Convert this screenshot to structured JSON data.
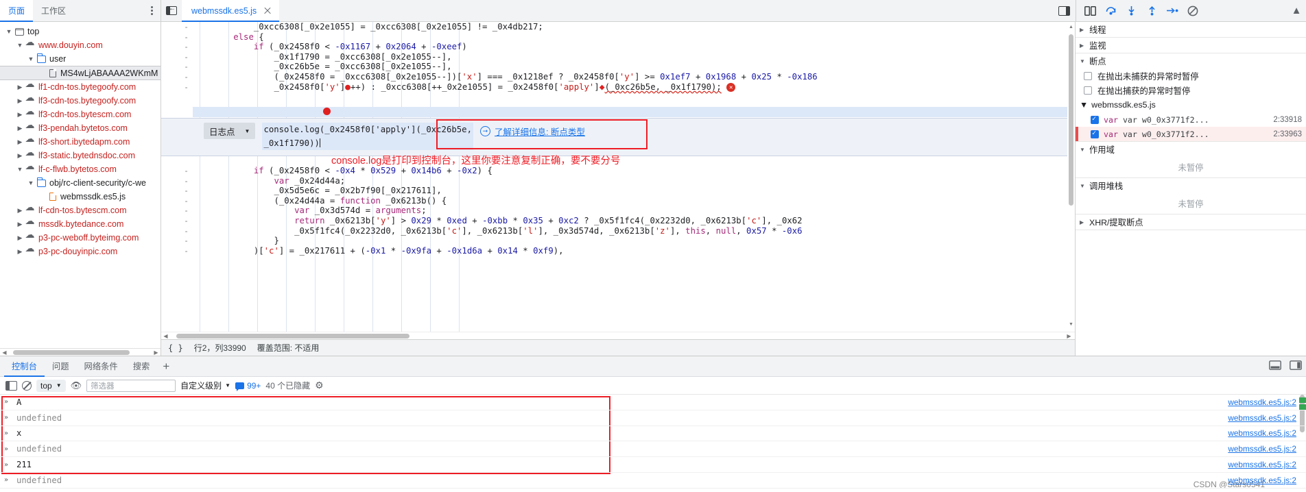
{
  "navigator": {
    "tabs": [
      {
        "label": "页面",
        "active": true
      },
      {
        "label": "工作区",
        "active": false
      }
    ],
    "more_label": "更多选项",
    "tree": [
      {
        "label": "top",
        "icon": "frame-icon",
        "depth": 0,
        "twisty": "open",
        "kind": "frame"
      },
      {
        "label": "www.douyin.com",
        "icon": "cloud-icon",
        "depth": 1,
        "twisty": "open",
        "kind": "host"
      },
      {
        "label": "user",
        "icon": "folder-icon",
        "depth": 2,
        "twisty": "open",
        "kind": "folder"
      },
      {
        "label": "MS4wLjABAAAA2WKmM",
        "icon": "document-icon",
        "depth": 3,
        "twisty": "none",
        "kind": "doc",
        "selected": true
      },
      {
        "label": "lf1-cdn-tos.bytegoofy.com",
        "icon": "cloud-icon",
        "depth": 1,
        "twisty": "closed",
        "kind": "host"
      },
      {
        "label": "lf3-cdn-tos.bytegoofy.com",
        "icon": "cloud-icon",
        "depth": 1,
        "twisty": "closed",
        "kind": "host"
      },
      {
        "label": "lf3-cdn-tos.bytescm.com",
        "icon": "cloud-icon",
        "depth": 1,
        "twisty": "closed",
        "kind": "host"
      },
      {
        "label": "lf3-pendah.bytetos.com",
        "icon": "cloud-icon",
        "depth": 1,
        "twisty": "closed",
        "kind": "host"
      },
      {
        "label": "lf3-short.ibytedapm.com",
        "icon": "cloud-icon",
        "depth": 1,
        "twisty": "closed",
        "kind": "host"
      },
      {
        "label": "lf3-static.bytednsdoc.com",
        "icon": "cloud-icon",
        "depth": 1,
        "twisty": "closed",
        "kind": "host"
      },
      {
        "label": "lf-c-flwb.bytetos.com",
        "icon": "cloud-icon",
        "depth": 1,
        "twisty": "open",
        "kind": "host"
      },
      {
        "label": "obj/rc-client-security/c-we",
        "icon": "folder-icon",
        "depth": 2,
        "twisty": "open",
        "kind": "folder"
      },
      {
        "label": "webmssdk.es5.js",
        "icon": "js-document-icon",
        "depth": 3,
        "twisty": "none",
        "kind": "js"
      },
      {
        "label": "lf-cdn-tos.bytescm.com",
        "icon": "cloud-icon",
        "depth": 1,
        "twisty": "closed",
        "kind": "host"
      },
      {
        "label": "mssdk.bytedance.com",
        "icon": "cloud-icon",
        "depth": 1,
        "twisty": "closed",
        "kind": "host"
      },
      {
        "label": "p3-pc-weboff.byteimg.com",
        "icon": "cloud-icon",
        "depth": 1,
        "twisty": "closed",
        "kind": "host"
      },
      {
        "label": "p3-pc-douyinpic.com",
        "icon": "cloud-icon",
        "depth": 1,
        "twisty": "closed",
        "kind": "host"
      }
    ]
  },
  "editor": {
    "tab_label": "webmssdk.es5.js",
    "close_label": "关闭",
    "show_navigator_label": "显示导航器",
    "status": {
      "format_label": "{ }",
      "position": "行2，列33990",
      "coverage": "覆盖范围: 不适用"
    },
    "lines": [
      {
        "gutter": "-",
        "indent": 0,
        "tokens": [
          {
            "t": "            ",
            "c": "plain"
          },
          {
            "t": "_0xcc6308[_0x2e1055] = _0xcc6308[_0x2e1055] != _0x4db217;",
            "c": "plain"
          }
        ]
      },
      {
        "gutter": "-",
        "indent": 0,
        "tokens": [
          {
            "t": "        ",
            "c": "plain"
          },
          {
            "t": "else",
            "c": "kw"
          },
          {
            "t": " {",
            "c": "plain"
          }
        ]
      },
      {
        "gutter": "-",
        "indent": 0,
        "tokens": [
          {
            "t": "            ",
            "c": "plain"
          },
          {
            "t": "if",
            "c": "kw"
          },
          {
            "t": " (_0x2458f0 < ",
            "c": "plain"
          },
          {
            "t": "-0x1167",
            "c": "num"
          },
          {
            "t": " + ",
            "c": "plain"
          },
          {
            "t": "0x2064",
            "c": "num"
          },
          {
            "t": " + ",
            "c": "plain"
          },
          {
            "t": "-0xeef",
            "c": "num"
          },
          {
            "t": ")",
            "c": "plain"
          }
        ]
      },
      {
        "gutter": "-",
        "indent": 0,
        "tokens": [
          {
            "t": "                _0x1f1790 = _0xcc6308[_0x2e1055--],",
            "c": "plain"
          }
        ]
      },
      {
        "gutter": "-",
        "indent": 0,
        "tokens": [
          {
            "t": "                _0xc26b5e = _0xcc6308[_0x2e1055--],",
            "c": "plain"
          }
        ]
      },
      {
        "gutter": "-",
        "indent": 0,
        "tokens": [
          {
            "t": "                (_0x2458f0 = _0xcc6308[_0x2e1055--])[",
            "c": "plain"
          },
          {
            "t": "'x'",
            "c": "str"
          },
          {
            "t": "] === _0x1218ef ? _0x2458f0[",
            "c": "plain"
          },
          {
            "t": "'y'",
            "c": "str"
          },
          {
            "t": "] >= ",
            "c": "plain"
          },
          {
            "t": "0x1ef7",
            "c": "num"
          },
          {
            "t": " + ",
            "c": "plain"
          },
          {
            "t": "0x1968",
            "c": "num"
          },
          {
            "t": " + ",
            "c": "plain"
          },
          {
            "t": "0x25",
            "c": "num"
          },
          {
            "t": " * ",
            "c": "plain"
          },
          {
            "t": "-0x186",
            "c": "num"
          }
        ]
      },
      {
        "gutter": "-",
        "indent": 0,
        "breakpoint": true,
        "tokens": [
          {
            "t": "                _0x2458f0[",
            "c": "plain"
          },
          {
            "t": "'y'",
            "c": "str"
          },
          {
            "t": "]",
            "c": "plain"
          },
          {
            "t": "●",
            "c": "bpdot"
          },
          {
            "t": "++) : _0xcc6308[++_0x2e1055] = _0x2458f0[",
            "c": "plain"
          },
          {
            "t": "'apply'",
            "c": "str"
          },
          {
            "t": "]",
            "c": "plain"
          },
          {
            "t": "◆",
            "c": "bpdot"
          },
          {
            "t": "(_0xc26b5e, _0x1f1790);",
            "c": "squiggle"
          },
          {
            "t": " ✕",
            "c": "errx"
          }
        ]
      }
    ],
    "lines_after": [
      {
        "gutter": "-",
        "tokens": [
          {
            "t": "            ",
            "c": "plain"
          },
          {
            "t": "if",
            "c": "kw"
          },
          {
            "t": " (_0x2458f0 < ",
            "c": "plain"
          },
          {
            "t": "-0x4",
            "c": "num"
          },
          {
            "t": " * ",
            "c": "plain"
          },
          {
            "t": "0x529",
            "c": "num"
          },
          {
            "t": " + ",
            "c": "plain"
          },
          {
            "t": "0x14b6",
            "c": "num"
          },
          {
            "t": " + ",
            "c": "plain"
          },
          {
            "t": "-0x2",
            "c": "num"
          },
          {
            "t": ") {",
            "c": "plain"
          }
        ]
      },
      {
        "gutter": "-",
        "tokens": [
          {
            "t": "                ",
            "c": "plain"
          },
          {
            "t": "var",
            "c": "kw"
          },
          {
            "t": " _0x24d44a;",
            "c": "plain"
          }
        ]
      },
      {
        "gutter": "-",
        "tokens": [
          {
            "t": "                _0x5d5e6c = _0x2b7f90[_0x217611],",
            "c": "plain"
          }
        ]
      },
      {
        "gutter": "-",
        "tokens": [
          {
            "t": "                (_0x24d44a = ",
            "c": "plain"
          },
          {
            "t": "function",
            "c": "kw"
          },
          {
            "t": " _0x6213b() {",
            "c": "plain"
          }
        ]
      },
      {
        "gutter": "-",
        "tokens": [
          {
            "t": "                    ",
            "c": "plain"
          },
          {
            "t": "var",
            "c": "kw"
          },
          {
            "t": " _0x3d574d = ",
            "c": "plain"
          },
          {
            "t": "arguments",
            "c": "kwv"
          },
          {
            "t": ";",
            "c": "plain"
          }
        ]
      },
      {
        "gutter": "-",
        "tokens": [
          {
            "t": "                    ",
            "c": "plain"
          },
          {
            "t": "return",
            "c": "kw"
          },
          {
            "t": " _0x6213b[",
            "c": "plain"
          },
          {
            "t": "'y'",
            "c": "str"
          },
          {
            "t": "] > ",
            "c": "plain"
          },
          {
            "t": "0x29",
            "c": "num"
          },
          {
            "t": " * ",
            "c": "plain"
          },
          {
            "t": "0xed",
            "c": "num"
          },
          {
            "t": " + ",
            "c": "plain"
          },
          {
            "t": "-0xbb",
            "c": "num"
          },
          {
            "t": " * ",
            "c": "plain"
          },
          {
            "t": "0x35",
            "c": "num"
          },
          {
            "t": " + ",
            "c": "plain"
          },
          {
            "t": "0xc2",
            "c": "num"
          },
          {
            "t": " ? _0x5f1fc4(_0x2232d0, _0x6213b[",
            "c": "plain"
          },
          {
            "t": "'c'",
            "c": "str"
          },
          {
            "t": "], _0x62",
            "c": "plain"
          }
        ]
      },
      {
        "gutter": "-",
        "tokens": [
          {
            "t": "                    _0x5f1fc4(_0x2232d0, _0x6213b[",
            "c": "plain"
          },
          {
            "t": "'c'",
            "c": "str"
          },
          {
            "t": "], _0x6213b[",
            "c": "plain"
          },
          {
            "t": "'l'",
            "c": "str"
          },
          {
            "t": "], _0x3d574d, _0x6213b[",
            "c": "plain"
          },
          {
            "t": "'z'",
            "c": "str"
          },
          {
            "t": "], ",
            "c": "plain"
          },
          {
            "t": "this",
            "c": "kw"
          },
          {
            "t": ", ",
            "c": "plain"
          },
          {
            "t": "null",
            "c": "kw"
          },
          {
            "t": ", ",
            "c": "plain"
          },
          {
            "t": "0x57",
            "c": "num"
          },
          {
            "t": " * ",
            "c": "plain"
          },
          {
            "t": "-0x6",
            "c": "num"
          }
        ]
      },
      {
        "gutter": "-",
        "tokens": [
          {
            "t": "                }",
            "c": "plain"
          }
        ]
      },
      {
        "gutter": "-",
        "tokens": [
          {
            "t": "            )[",
            "c": "plain"
          },
          {
            "t": "'c'",
            "c": "str"
          },
          {
            "t": "] = _0x217611 + (",
            "c": "plain"
          },
          {
            "t": "-0x1",
            "c": "num"
          },
          {
            "t": " * ",
            "c": "plain"
          },
          {
            "t": "-0x9fa",
            "c": "num"
          },
          {
            "t": " + ",
            "c": "plain"
          },
          {
            "t": "-0x1d6a",
            "c": "num"
          },
          {
            "t": " + ",
            "c": "plain"
          },
          {
            "t": "0x14",
            "c": "num"
          },
          {
            "t": " * ",
            "c": "plain"
          },
          {
            "t": "0xf9",
            "c": "num"
          },
          {
            "t": "),",
            "c": "plain"
          }
        ]
      }
    ]
  },
  "breakpoint_editor": {
    "type_label": "日志点",
    "caret_glyph": "▼",
    "expression_line1": "console.log(_0x2458f0['apply'](_0xc26b5e,",
    "expression_line2": "_0x1f1790))",
    "learn_more": "了解详细信息: 断点类型",
    "learn_icon": "arrow-circle-icon"
  },
  "annotation": {
    "note": "console.log是打印到控制台，这里你要注意复制正确，要不要分号",
    "color": "#ee1c25"
  },
  "debugger": {
    "toolbar": {
      "pause_label": "暂停脚本执行",
      "step_over_label": "跳过下一个函数调用",
      "step_into_label": "进入下一个函数调用",
      "step_out_label": "跳出当前函数",
      "step_label": "步进",
      "deactivate_label": "停用断点"
    },
    "sections": [
      {
        "title": "线程",
        "expanded": false
      },
      {
        "title": "监视",
        "expanded": false
      },
      {
        "title": "断点",
        "expanded": true
      },
      {
        "title": "作用域",
        "expanded": true,
        "empty": "未暂停"
      },
      {
        "title": "调用堆栈",
        "expanded": true,
        "empty": "未暂停"
      },
      {
        "title": "XHR/提取断点",
        "expanded": false
      }
    ],
    "pause_options": [
      {
        "label": "在抛出未捕获的异常时暂停",
        "checked": false
      },
      {
        "label": "在抛出捕获的异常时暂停",
        "checked": false
      }
    ],
    "breakpoint_file": "webmssdk.es5.js",
    "breakpoints": [
      {
        "checked": true,
        "code": "var w0_0x3771f2...",
        "line": "2:33918",
        "current": false
      },
      {
        "checked": true,
        "code": "var w0_0x3771f2...",
        "line": "2:33963",
        "current": true
      }
    ]
  },
  "drawer": {
    "tabs": [
      {
        "label": "控制台",
        "active": true
      },
      {
        "label": "问题",
        "active": false
      },
      {
        "label": "网络条件",
        "active": false
      },
      {
        "label": "搜索",
        "active": false
      }
    ],
    "add_tab_label": "+",
    "toolbar": {
      "sidebar_label": "显示控制台侧边栏",
      "clear_label": "清空控制台",
      "context": "top",
      "context_caret": "▼",
      "eye_label": "实时表达式",
      "filter_placeholder": "筛选器",
      "filter_value": "",
      "level_label": "自定义级别",
      "level_caret": "▼",
      "issues_count": "99+",
      "hidden_count": "40 个已隐藏",
      "settings_label": "控制台设置"
    },
    "messages": [
      {
        "arrow": "»",
        "text": "A",
        "muted": false,
        "source": "webmssdk.es5.js:2"
      },
      {
        "arrow": "»",
        "text": "undefined",
        "muted": true,
        "source": "webmssdk.es5.js:2"
      },
      {
        "arrow": "»",
        "text": "x",
        "muted": false,
        "source": "webmssdk.es5.js:2"
      },
      {
        "arrow": "»",
        "text": "undefined",
        "muted": true,
        "source": "webmssdk.es5.js:2"
      },
      {
        "arrow": "»",
        "text": "211",
        "muted": false,
        "source": "webmssdk.es5.js:2"
      },
      {
        "arrow": "»",
        "text": "undefined",
        "muted": true,
        "source": "webmssdk.es5.js:2"
      }
    ]
  },
  "watermark": "CSDN @Stars0541"
}
